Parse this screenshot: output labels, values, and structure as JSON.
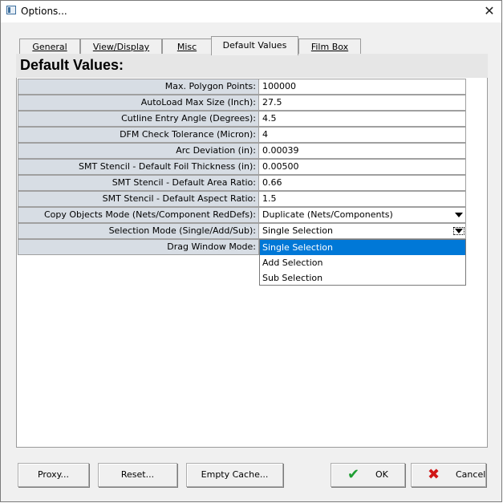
{
  "window": {
    "title": "Options...",
    "close_glyph": "✕"
  },
  "tabs": [
    {
      "label": "General"
    },
    {
      "label": "View/Display"
    },
    {
      "label": "Misc"
    },
    {
      "label": "Default Values"
    },
    {
      "label": "Film Box"
    }
  ],
  "active_tab": "Default Values",
  "panel": {
    "heading": "Default Values:"
  },
  "rows": [
    {
      "label": "Max. Polygon Points:",
      "value": "100000"
    },
    {
      "label": "AutoLoad Max Size (Inch):",
      "value": "27.5"
    },
    {
      "label": "Cutline Entry Angle (Degrees):",
      "value": "4.5"
    },
    {
      "label": "DFM Check Tolerance (Micron):",
      "value": "4"
    },
    {
      "label": "Arc Deviation (in):",
      "value": "0.00039"
    },
    {
      "label": "SMT Stencil - Default Foil Thickness (in):",
      "value": "0.00500"
    },
    {
      "label": "SMT Stencil - Default Area Ratio:",
      "value": "0.66"
    },
    {
      "label": "SMT Stencil - Default Aspect Ratio:",
      "value": "1.5"
    },
    {
      "label": "Copy Objects Mode (Nets/Component RedDefs):",
      "value": "Duplicate (Nets/Components)"
    },
    {
      "label": "Selection Mode (Single/Add/Sub):",
      "value": "Single Selection"
    },
    {
      "label": "Drag Window Mode:",
      "value": ""
    }
  ],
  "dropdown": {
    "options": [
      "Single Selection",
      "Add Selection",
      "Sub Selection"
    ],
    "selected": "Single Selection"
  },
  "buttons": {
    "proxy": "Proxy...",
    "reset": "Reset...",
    "empty_cache": "Empty Cache...",
    "ok": "OK",
    "cancel": "Cancel"
  },
  "icons": {
    "ok": "check-icon",
    "cancel": "x-icon"
  },
  "colors": {
    "ok_icon": "#1e9e32",
    "cancel_icon": "#d01616",
    "selection": "#0078d7",
    "label_bg": "#d7dde4"
  }
}
